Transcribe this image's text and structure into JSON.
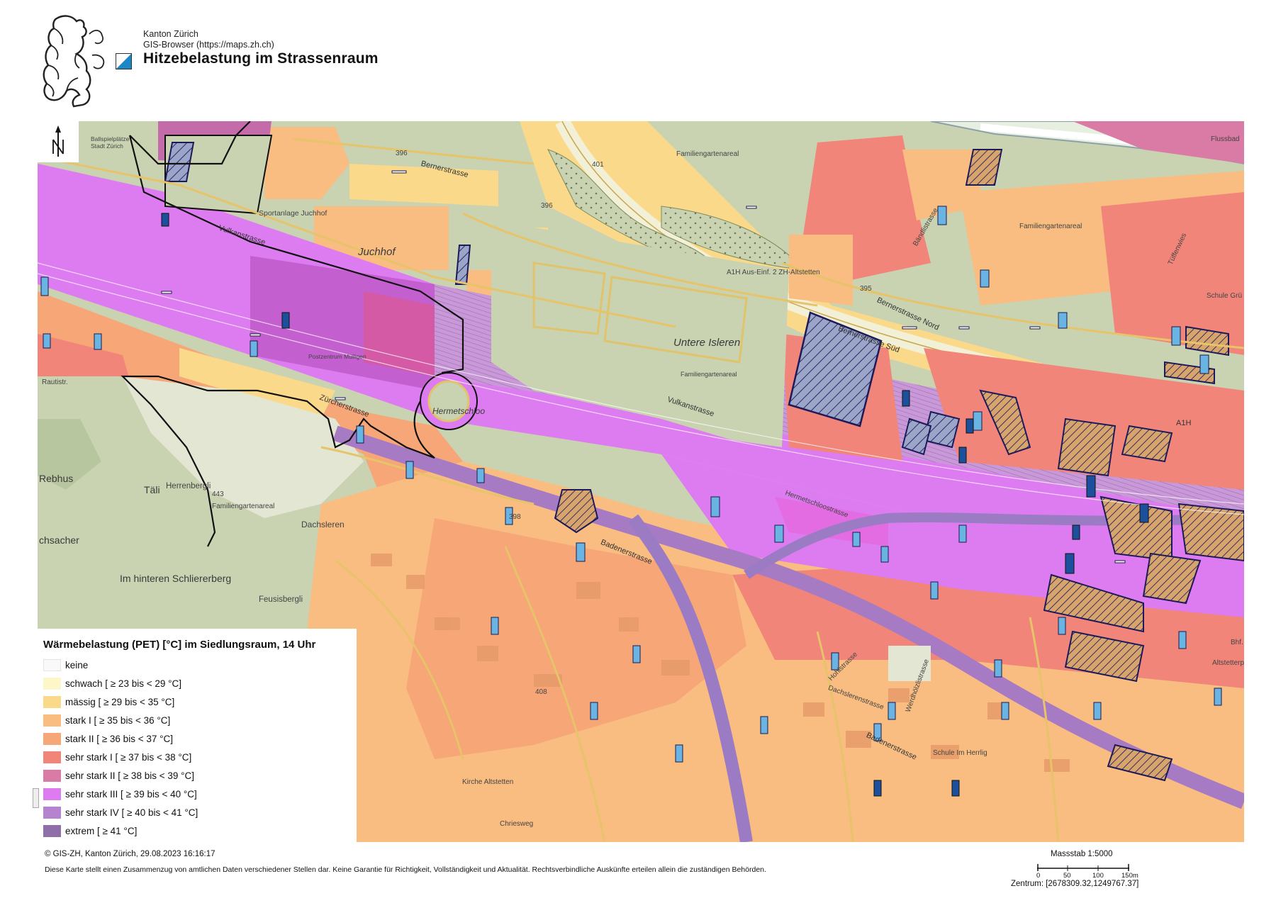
{
  "header": {
    "org_line1": "Kanton Zürich",
    "org_line2": "GIS-Browser (https://maps.zh.ch)",
    "title": "Hitzebelastung im Strassenraum",
    "emblem": "zurich-lion-emblem",
    "flag_colors": [
      "#ffffff",
      "#1a87c9"
    ]
  },
  "map": {
    "north_arrow": "north-arrow-icon",
    "labels": {
      "juchhof": "Juchhof",
      "untere_isleren": "Untere Isleren",
      "hermetschloo": "Hermetschloo",
      "rebhus": "Rebhus",
      "taeli": "Täli",
      "herrenbergli": "Herrenbergli",
      "dachsleren": "Dachsleren",
      "schlierer": "Im hinteren Schliererberg",
      "feusisbergli": "Feusisbergli",
      "chsacher": "chsacher",
      "sportanlage": "Sportanlage Juchhof",
      "postzentrum": "Postzentrum Mülligen",
      "familiengarten1": "Familiengartenareal",
      "familiengarten2": "Familiengartenareal",
      "familiengarten3": "Familiengartenareal",
      "familiengarten4": "Familiengartenareal",
      "bernerstrasse": "Bernerstrasse",
      "vulkanstrasse": "Vulkanstrasse",
      "vulkanstrasse2": "Vulkanstrasse",
      "zuercherstrasse": "Zürcherstrasse",
      "badenerstrasse": "Badenerstrasse",
      "badenerstrasse2": "Badenerstrasse",
      "bernerstrasse_nord": "Bernerstrasse Nord",
      "bernerstrasse_sued": "Bernerstrasse Süd",
      "a1h": "A1H",
      "a1h_exit": "A1H Aus-Einf. 2 ZH-Altstetten",
      "hermetschloostrasse": "Hermetschloostrasse",
      "bandlistrasse": "Bändlistrasse",
      "schule_im_herrlig": "Schule Im Herrlig",
      "flussbad": "Flussbad",
      "schule_gr": "Schule Grü",
      "dachslerenstr": "Dachslerenstrasse",
      "altstetterpl": "Altstetterpl.",
      "kirche": "Kirche Altstetten",
      "chriesweg": "Chriesweg",
      "rautistrasse": "Rautistr.",
      "tuffenwies": "Tüffenwies",
      "bahnhof": "Bhf. A",
      "ballspiel": "Ballspielplätze Stadt Zürich",
      "hohlstrasse": "Hohlstrasse",
      "werdhoelzli": "Werdhölzlistrasse",
      "num_396a": "396",
      "num_396b": "396",
      "num_401": "401",
      "num_398": "398",
      "num_443": "443",
      "num_395": "395",
      "num_408": "408"
    }
  },
  "legend": {
    "title": "Wärmebelastung (PET) [°C] im Siedlungsraum, 14 Uhr",
    "items": [
      {
        "label": "keine",
        "color": "#f9f9f9"
      },
      {
        "label": "schwach [ ≥ 23 bis < 29 °C]",
        "color": "#fdf6c8"
      },
      {
        "label": "mässig [ ≥ 29 bis < 35 °C]",
        "color": "#fbd98a"
      },
      {
        "label": "stark I [ ≥ 35 bis < 36 °C]",
        "color": "#f9bd82"
      },
      {
        "label": "stark II [ ≥ 36 bis < 37 °C]",
        "color": "#f6a677"
      },
      {
        "label": "sehr stark I [ ≥ 37 bis < 38 °C]",
        "color": "#f2857a"
      },
      {
        "label": "sehr stark II [ ≥ 38 bis < 39 °C]",
        "color": "#d97ba4"
      },
      {
        "label": "sehr stark III [ ≥ 39 bis < 40 °C]",
        "color": "#dd7cf0"
      },
      {
        "label": "sehr stark IV [ ≥ 40 bis < 41 °C]",
        "color": "#b583cf"
      },
      {
        "label": "extrem [ ≥ 41 °C]",
        "color": "#8e6fa8"
      }
    ]
  },
  "footer": {
    "copyright": "© GIS-ZH, Kanton Zürich, 29.08.2023 16:16:17",
    "disclaimer": "Diese Karte stellt einen Zusammenzug von amtlichen Daten verschiedener Stellen dar. Keine Garantie für Richtigkeit, Vollständigkeit und Aktualität. Rechtsverbindliche Auskünfte erteilen allein die zuständigen Behörden.",
    "scale_title": "Massstab 1:5000",
    "scale_ticks": [
      "0",
      "50",
      "100",
      "150m"
    ],
    "center": "Zentrum: [2678309.32,1249767.37]"
  }
}
